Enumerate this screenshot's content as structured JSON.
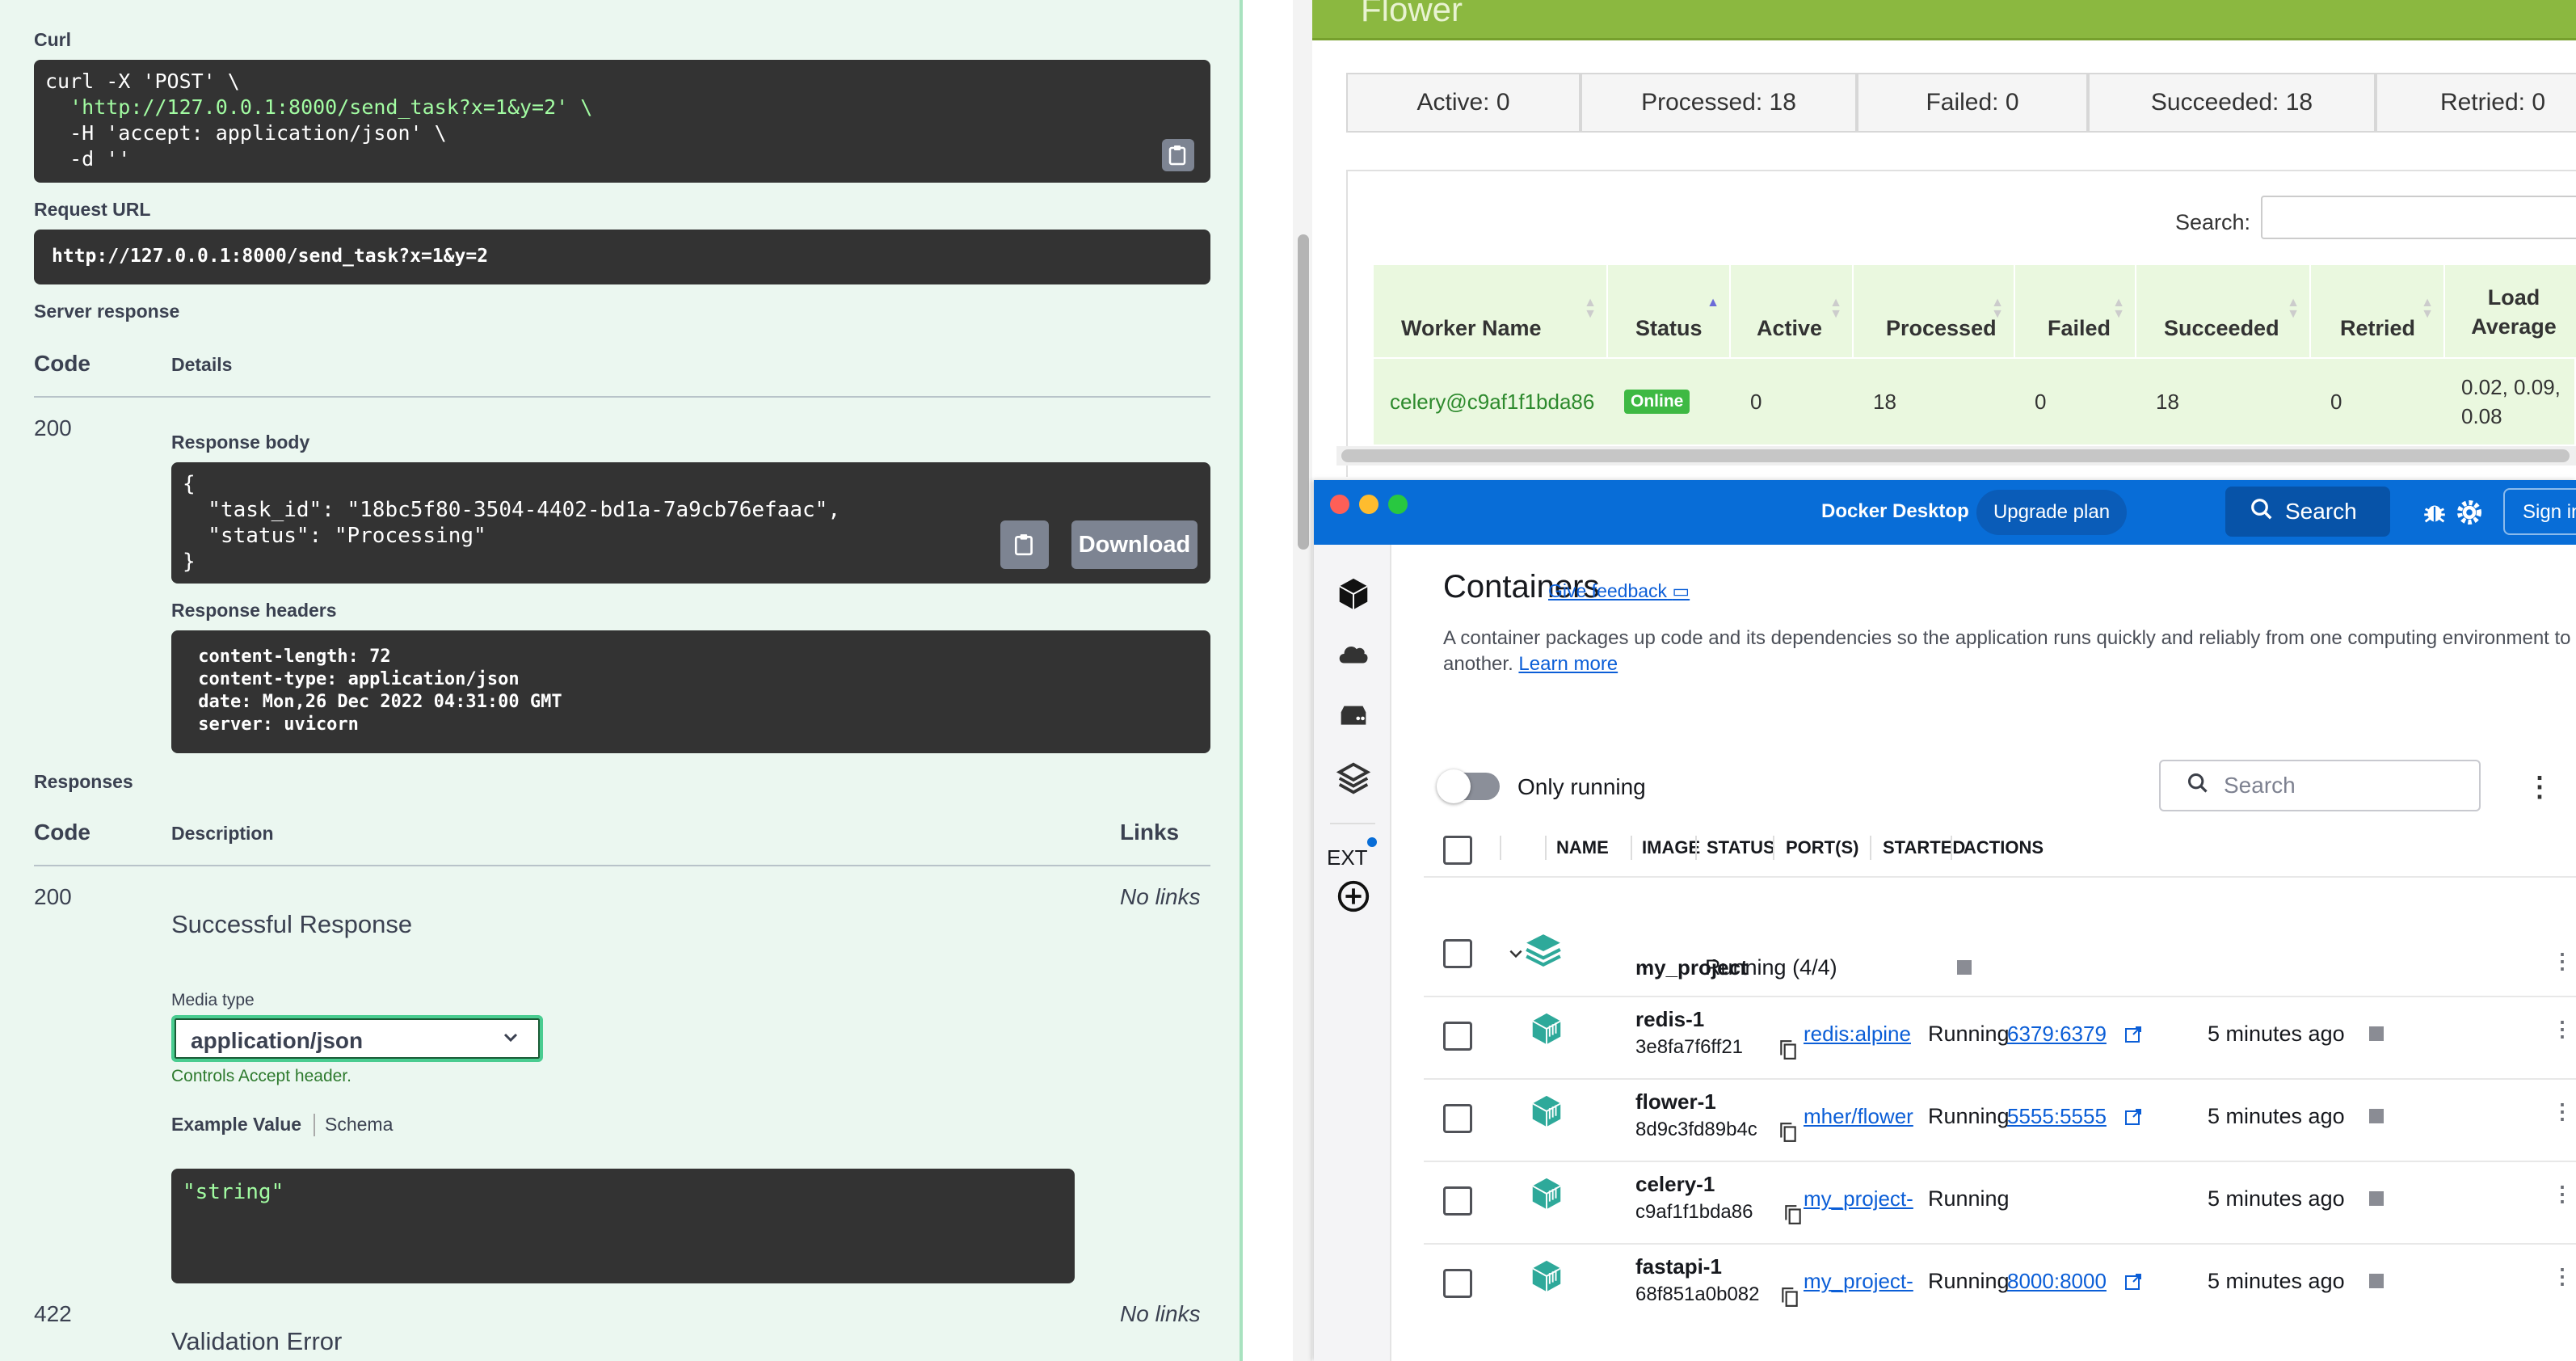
{
  "swagger": {
    "curl_label": "Curl",
    "curl_lines": [
      "curl -X 'POST' \\",
      "  'http://127.0.0.1:8000/send_task?x=1&y=2' \\",
      "  -H 'accept: application/json' \\",
      "  -d ''"
    ],
    "request_url_label": "Request URL",
    "request_url": "http://127.0.0.1:8000/send_task?x=1&y=2",
    "server_response_label": "Server response",
    "code_header": "Code",
    "details_header": "Details",
    "response_code": "200",
    "response_body_label": "Response body",
    "response_body_lines": [
      "{",
      "  \"task_id\": \"18bc5f80-3504-4402-bd1a-7a9cb76efaac\",",
      "  \"status\": \"Processing\"",
      "}"
    ],
    "download_label": "Download",
    "response_headers_label": "Response headers",
    "response_headers_lines": [
      " content-length: 72 ",
      " content-type: application/json ",
      " date: Mon,26 Dec 2022 04:31:00 GMT ",
      " server: uvicorn "
    ],
    "responses_label": "Responses",
    "description_header": "Description",
    "links_header": "Links",
    "resp200_code": "200",
    "resp200_desc": "Successful Response",
    "resp200_links": "No links",
    "media_type_label": "Media type",
    "media_type_value": "application/json",
    "controls_accept": "Controls Accept header.",
    "example_value_tab": "Example Value",
    "schema_tab": "Schema",
    "example_value": "\"string\"",
    "resp422_code": "422",
    "resp422_desc": "Validation Error",
    "resp422_links": "No links"
  },
  "flower": {
    "title": "Flower",
    "stats": [
      "Active: 0",
      "Processed: 18",
      "Failed: 0",
      "Succeeded: 18",
      "Retried: 0"
    ],
    "search_label": "Search:",
    "columns": [
      "Worker Name",
      "Status",
      "Active",
      "Processed",
      "Failed",
      "Succeeded",
      "Retried",
      "Load Average"
    ],
    "row": {
      "worker": "celery@c9af1f1bda86",
      "status": "Online",
      "active": "0",
      "processed": "18",
      "failed": "0",
      "succeeded": "18",
      "retried": "0",
      "load_average": "0.02, 0.09, 0.08"
    }
  },
  "docker": {
    "app_title": "Docker Desktop",
    "upgrade_label": "Upgrade plan",
    "search_label": "Search",
    "signin_label": "Sign in",
    "ext_label": "EXT",
    "page_title": "Containers",
    "feedback_label": "Give feedback",
    "description_line1": "A container packages up code and its dependencies so the application runs quickly and reliably from one computing environment to",
    "description_line2": "another.",
    "learn_more": "Learn more",
    "only_running_label": "Only running",
    "search_placeholder": "Search",
    "columns": [
      "NAME",
      "IMAGE",
      "STATUS",
      "PORT(S)",
      "STARTED",
      "ACTIONS"
    ],
    "project": {
      "name": "my_project",
      "image": "-",
      "status": "Running (4/4)"
    },
    "containers": [
      {
        "name": "redis-1",
        "id": "3e8fa7f6ff21",
        "image": "redis:alpine",
        "status": "Running",
        "port": "6379:6379",
        "started": "5 minutes ago"
      },
      {
        "name": "flower-1",
        "id": "8d9c3fd89b4c",
        "image": "mher/flower",
        "status": "Running",
        "port": "5555:5555",
        "started": "5 minutes ago"
      },
      {
        "name": "celery-1",
        "id": "c9af1f1bda86",
        "image": "my_project-",
        "status": "Running",
        "port": "",
        "started": "5 minutes ago"
      },
      {
        "name": "fastapi-1",
        "id": "68f851a0b082",
        "image": "my_project-",
        "status": "Running",
        "port": "8000:8000",
        "started": "5 minutes ago"
      }
    ],
    "colors": {
      "header": "#086dd7",
      "teal": "#2ea99a",
      "link": "#0b5ed7"
    }
  }
}
